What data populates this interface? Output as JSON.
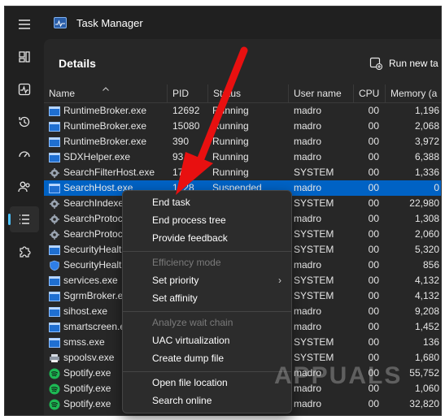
{
  "window": {
    "title": "Task Manager"
  },
  "page": {
    "title": "Details",
    "run_new_task": "Run new ta"
  },
  "columns": {
    "name": "Name",
    "pid": "PID",
    "status": "Status",
    "user": "User name",
    "cpu": "CPU",
    "memory": "Memory (a"
  },
  "rows": [
    {
      "name": "RuntimeBroker.exe",
      "pid": "12692",
      "status": "Running",
      "user": "madro",
      "cpu": "00",
      "mem": "1,196",
      "icon": "window-icon"
    },
    {
      "name": "RuntimeBroker.exe",
      "pid": "15080",
      "status": "Running",
      "user": "madro",
      "cpu": "00",
      "mem": "2,068",
      "icon": "window-icon"
    },
    {
      "name": "RuntimeBroker.exe",
      "pid": "390",
      "status": "Running",
      "user": "madro",
      "cpu": "00",
      "mem": "3,972",
      "icon": "window-icon"
    },
    {
      "name": "SDXHelper.exe",
      "pid": "93",
      "status": "Running",
      "user": "madro",
      "cpu": "00",
      "mem": "6,388",
      "icon": "window-icon"
    },
    {
      "name": "SearchFilterHost.exe",
      "pid": "17",
      "status": "Running",
      "user": "SYSTEM",
      "cpu": "00",
      "mem": "1,336",
      "icon": "service-icon"
    },
    {
      "name": "SearchHost.exe",
      "pid": "1228",
      "status": "Suspended",
      "user": "madro",
      "cpu": "00",
      "mem": "0",
      "icon": "window-icon",
      "selected": true
    },
    {
      "name": "SearchIndexer",
      "pid": "",
      "status": "",
      "user": "SYSTEM",
      "cpu": "00",
      "mem": "22,980",
      "icon": "service-icon"
    },
    {
      "name": "SearchProtoco",
      "pid": "",
      "status": "",
      "user": "madro",
      "cpu": "00",
      "mem": "1,308",
      "icon": "service-icon"
    },
    {
      "name": "SearchProtoco",
      "pid": "",
      "status": "",
      "user": "SYSTEM",
      "cpu": "00",
      "mem": "2,060",
      "icon": "service-icon"
    },
    {
      "name": "SecurityHealth",
      "pid": "",
      "status": "",
      "user": "SYSTEM",
      "cpu": "00",
      "mem": "5,320",
      "icon": "window-icon"
    },
    {
      "name": "SecurityHealth",
      "pid": "",
      "status": "",
      "user": "madro",
      "cpu": "00",
      "mem": "856",
      "icon": "shield-icon"
    },
    {
      "name": "services.exe",
      "pid": "",
      "status": "",
      "user": "SYSTEM",
      "cpu": "00",
      "mem": "4,132",
      "icon": "window-icon"
    },
    {
      "name": "SgrmBroker.ex",
      "pid": "",
      "status": "",
      "user": "SYSTEM",
      "cpu": "00",
      "mem": "4,132",
      "icon": "window-icon"
    },
    {
      "name": "sihost.exe",
      "pid": "",
      "status": "",
      "user": "madro",
      "cpu": "00",
      "mem": "9,208",
      "icon": "window-icon"
    },
    {
      "name": "smartscreen.e",
      "pid": "",
      "status": "",
      "user": "madro",
      "cpu": "00",
      "mem": "1,452",
      "icon": "window-icon"
    },
    {
      "name": "smss.exe",
      "pid": "",
      "status": "",
      "user": "SYSTEM",
      "cpu": "00",
      "mem": "136",
      "icon": "window-icon"
    },
    {
      "name": "spoolsv.exe",
      "pid": "",
      "status": "",
      "user": "SYSTEM",
      "cpu": "00",
      "mem": "1,680",
      "icon": "printer-icon"
    },
    {
      "name": "Spotify.exe",
      "pid": "",
      "status": "",
      "user": "madro",
      "cpu": "00",
      "mem": "55,752",
      "icon": "spotify-icon"
    },
    {
      "name": "Spotify.exe",
      "pid": "",
      "status": "",
      "user": "madro",
      "cpu": "00",
      "mem": "1,060",
      "icon": "spotify-icon"
    },
    {
      "name": "Spotify.exe",
      "pid": "",
      "status": "",
      "user": "madro",
      "cpu": "00",
      "mem": "32,820",
      "icon": "spotify-icon"
    }
  ],
  "context_menu": {
    "end_task": "End task",
    "end_process_tree": "End process tree",
    "provide_feedback": "Provide feedback",
    "efficiency_mode": "Efficiency mode",
    "set_priority": "Set priority",
    "set_affinity": "Set affinity",
    "analyze_wait_chain": "Analyze wait chain",
    "uac_virtualization": "UAC virtualization",
    "create_dump_file": "Create dump file",
    "open_file_location": "Open file location",
    "search_online": "Search online"
  },
  "watermark": "APPUALS",
  "colors": {
    "accent": "#4cc2ff",
    "selection": "#0062c4",
    "annotation_arrow": "#e81010",
    "spotify": "#1db954"
  }
}
